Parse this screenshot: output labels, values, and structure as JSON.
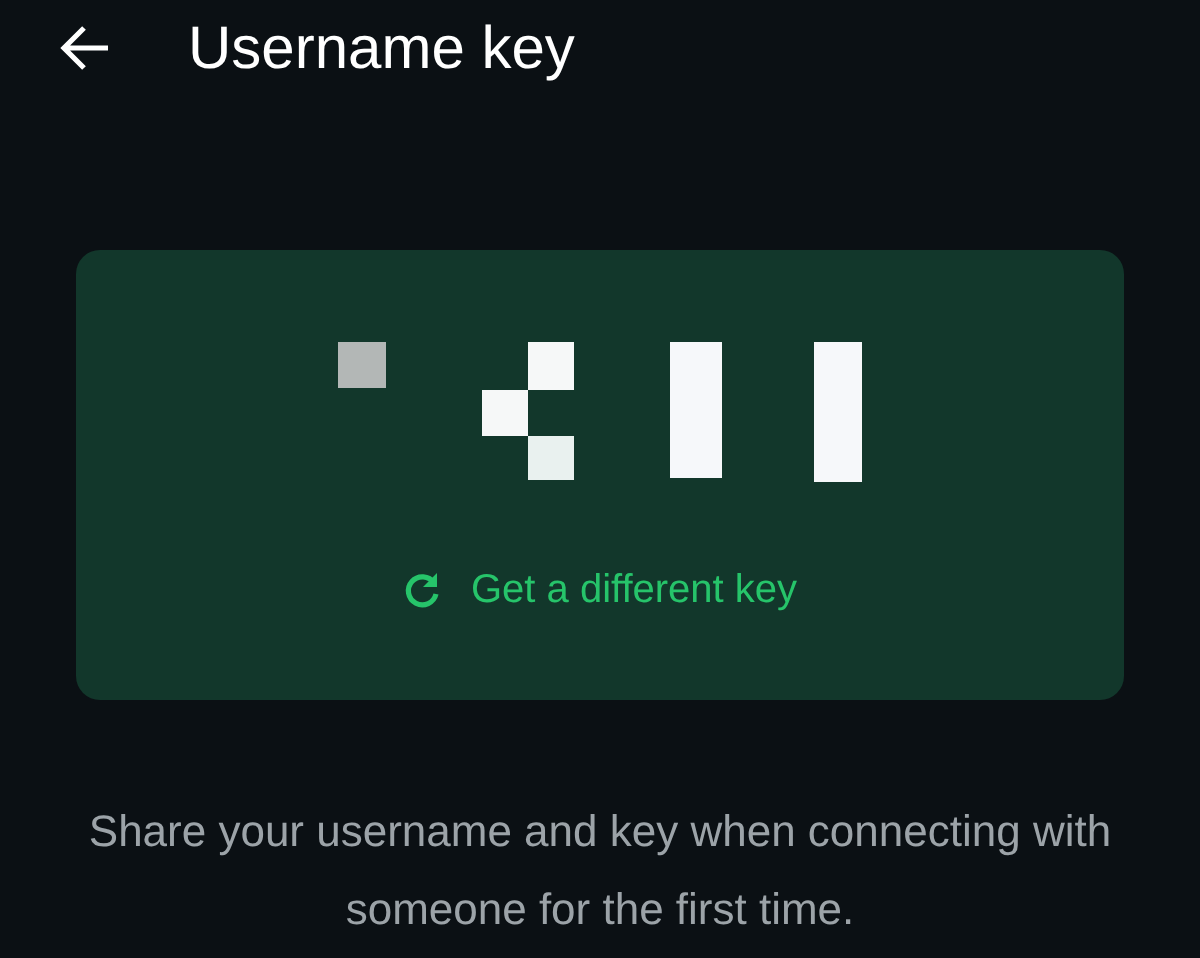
{
  "header": {
    "title": "Username key"
  },
  "key_card": {
    "action": "Get a different key"
  },
  "description": "Share your username and key when connecting with someone for the first time."
}
